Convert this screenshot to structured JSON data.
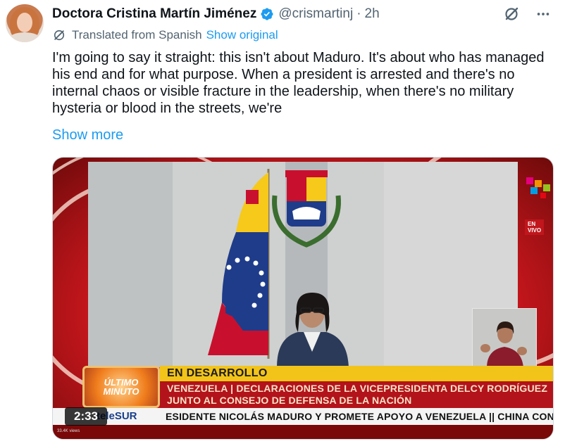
{
  "tweet": {
    "author_name": "Doctora Cristina Martín Jiménez",
    "handle": "@crismartinj",
    "separator": "·",
    "time": "2h",
    "translated_label": "Translated from Spanish",
    "show_original": "Show original",
    "text": "I'm going to say it straight: this isn't about Maduro. It's about who has managed his end and for what purpose. When a president is arrested and there's no internal chaos or visible fracture in the leadership, when there's no military hysteria or blood in the streets, we're",
    "show_more": "Show more"
  },
  "icons": {
    "verified": "verified-badge-icon",
    "grok": "grok-icon",
    "more": "more-icon",
    "translate": "translate-icon"
  },
  "video": {
    "duration": "2:33",
    "broadcast": {
      "ultimo_minuto_1": "ÚLTIMO",
      "ultimo_minuto_2": "MINUTO",
      "headline": "EN DESARROLLO",
      "subline_1": "VENEZUELA | DECLARACIONES DE LA VICEPRESIDENTA DELCY RODRÍGUEZ",
      "subline_2": "JUNTO AL CONSEJO DE DEFENSA DE LA NACIÓN",
      "channel": "teleSUR",
      "ticker": "ESIDENTE NICOLÁS MADURO Y PROMETE APOYO A VENEZUELA  ||  CHINA CONDEN",
      "live_badge": "EN VIVO",
      "logo_text": "SUR",
      "viewers": "33.4K views"
    }
  },
  "colors": {
    "link": "#1d9bf0",
    "text": "#0f1419",
    "secondary": "#536471",
    "verified": "#1d9bf0"
  }
}
